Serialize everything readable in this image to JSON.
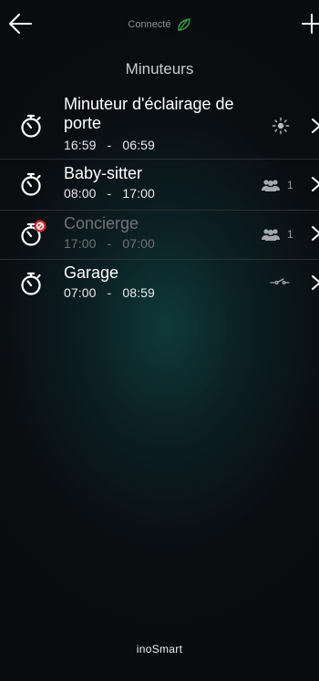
{
  "header": {
    "status_label": "Connecté",
    "title": "Minuteurs"
  },
  "timers": [
    {
      "name_line1": "Minuteur d'éclairage de",
      "name_line2": "porte",
      "start": "16:59",
      "end": "06:59",
      "separator": "-",
      "indicator_icon": "sun-icon",
      "enabled": true
    },
    {
      "name_line1": "Baby-sitter",
      "start": "08:00",
      "end": "17:00",
      "separator": "-",
      "indicator_icon": "group-icon",
      "indicator_count": "1",
      "enabled": true
    },
    {
      "name_line1": "Concierge",
      "start": "17:00",
      "end": "07:00",
      "separator": "-",
      "indicator_icon": "group-icon",
      "indicator_count": "1",
      "enabled": false
    },
    {
      "name_line1": "Garage",
      "start": "07:00",
      "end": "08:59",
      "separator": "-",
      "indicator_icon": "switch-icon",
      "enabled": true
    }
  ],
  "footer": {
    "brand": "inoSmart"
  },
  "colors": {
    "accent_disabled": "#d52b32",
    "background": "#0a0b0d"
  }
}
